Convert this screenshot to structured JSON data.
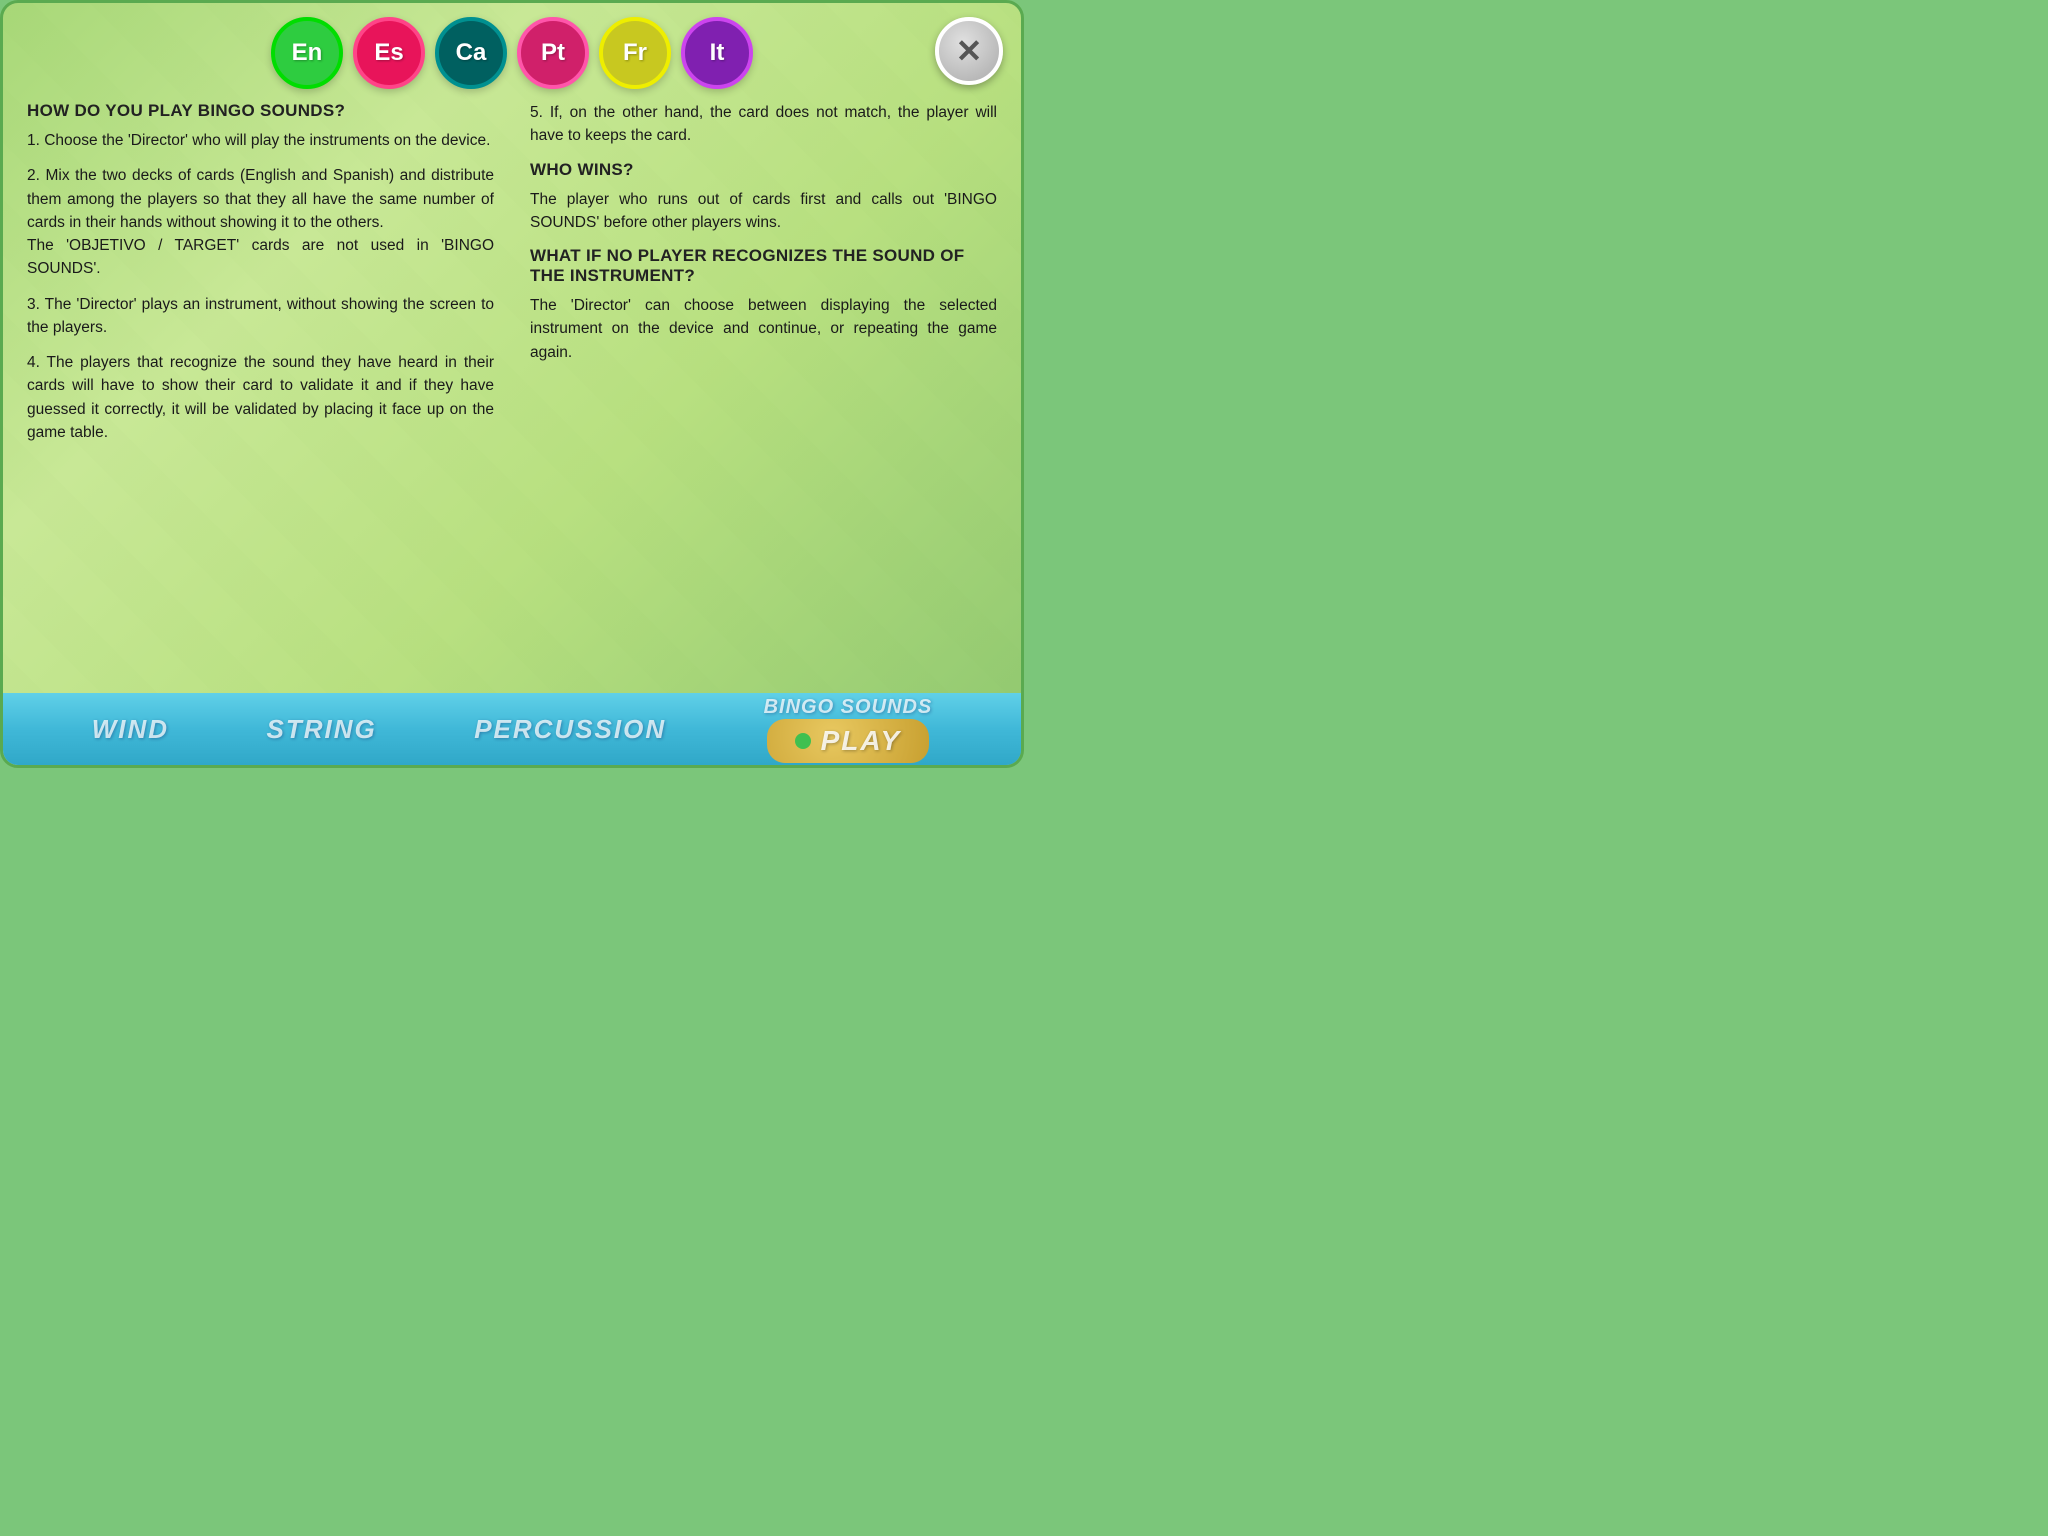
{
  "languages": [
    {
      "code": "En",
      "class": "en"
    },
    {
      "code": "Es",
      "class": "es"
    },
    {
      "code": "Ca",
      "class": "ca"
    },
    {
      "code": "Pt",
      "class": "pt"
    },
    {
      "code": "Fr",
      "class": "fr"
    },
    {
      "code": "It",
      "class": "it"
    }
  ],
  "close_button": "✕",
  "left_column": {
    "main_title": "HOW DO YOU PLAY BINGO SOUNDS?",
    "step1": "1. Choose the 'Director' who will play the instruments on the device.",
    "step2": "2. Mix the two decks of cards (English and Spanish) and distribute them among the players so that they all have the same number of cards in their hands without showing it to the others.\nThe 'OBJETIVO / TARGET' cards are not used in 'BINGO SOUNDS'.",
    "step3": "3. The 'Director' plays an instrument, without showing the screen to the players.",
    "step4": "4. The players that recognize the sound they have heard in their cards will have to show their card to validate it and if they have guessed it correctly, it will be validated by placing it face up on the game table."
  },
  "right_column": {
    "step5": "5.  If, on the other hand, the card does not match, the player will have to keeps the card.",
    "who_wins_title": "WHO WINS?",
    "who_wins_text": "The player who runs out of cards first and calls out 'BINGO SOUNDS' before other players wins.",
    "no_player_title": "WHAT IF NO PLAYER RECOGNIZES THE SOUND OF THE INSTRUMENT?",
    "no_player_text": "The 'Director' can choose between displaying the selected instrument on the device and continue, or repeating the game again."
  },
  "bottom_labels": [
    "WIND",
    "STRING",
    "PERCUSSION"
  ],
  "bingo_sounds_label": "BINGO SOUNDS",
  "play_label": "PLAY"
}
